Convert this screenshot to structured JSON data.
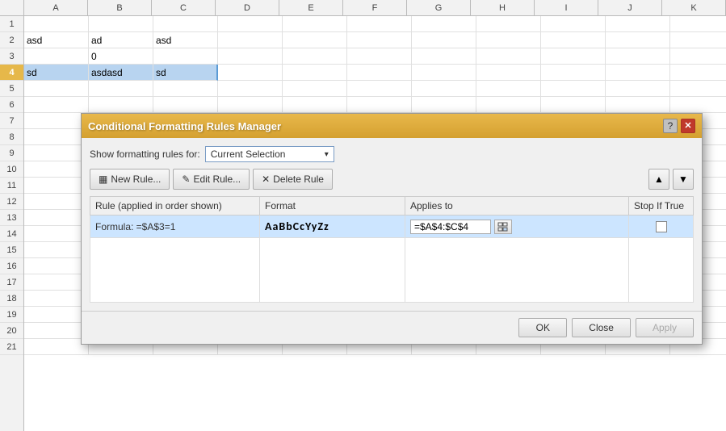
{
  "spreadsheet": {
    "col_headers": [
      "",
      "A",
      "B",
      "C",
      "D",
      "E",
      "F",
      "G",
      "H",
      "I",
      "J",
      "K"
    ],
    "rows": [
      {
        "num": "1",
        "cells": [
          "",
          "",
          "",
          "",
          "",
          "",
          "",
          "",
          "",
          "",
          ""
        ]
      },
      {
        "num": "2",
        "cells": [
          "asd",
          "ad",
          "asd",
          "",
          "",
          "",
          "",
          "",
          "",
          "",
          ""
        ]
      },
      {
        "num": "3",
        "cells": [
          "",
          "0",
          "",
          "",
          "",
          "",
          "",
          "",
          "",
          "",
          ""
        ]
      },
      {
        "num": "4",
        "cells": [
          "sd",
          "asdasd",
          "sd",
          "",
          "",
          "",
          "",
          "",
          "",
          "",
          ""
        ],
        "selected": true
      },
      {
        "num": "5",
        "cells": [
          "",
          "",
          "",
          "",
          "",
          "",
          "",
          "",
          "",
          "",
          ""
        ]
      },
      {
        "num": "6",
        "cells": [
          "",
          "",
          "",
          "",
          "",
          "",
          "",
          "",
          "",
          "",
          ""
        ]
      },
      {
        "num": "7",
        "cells": [
          "",
          "",
          "",
          "",
          "",
          "",
          "",
          "",
          "",
          "",
          ""
        ]
      },
      {
        "num": "8",
        "cells": [
          "",
          "",
          "",
          "",
          "",
          "",
          "",
          "",
          "",
          "",
          ""
        ]
      },
      {
        "num": "9",
        "cells": [
          "",
          "",
          "",
          "",
          "",
          "",
          "",
          "",
          "",
          "",
          ""
        ]
      },
      {
        "num": "10",
        "cells": [
          "",
          "",
          "",
          "",
          "",
          "",
          "",
          "",
          "",
          "",
          ""
        ]
      },
      {
        "num": "11",
        "cells": [
          "",
          "",
          "",
          "",
          "",
          "",
          "",
          "",
          "",
          "",
          ""
        ]
      },
      {
        "num": "12",
        "cells": [
          "",
          "",
          "",
          "",
          "",
          "",
          "",
          "",
          "",
          "",
          ""
        ]
      },
      {
        "num": "13",
        "cells": [
          "",
          "",
          "",
          "",
          "",
          "",
          "",
          "",
          "",
          "",
          ""
        ]
      },
      {
        "num": "14",
        "cells": [
          "",
          "",
          "",
          "",
          "",
          "",
          "",
          "",
          "",
          "",
          ""
        ]
      },
      {
        "num": "15",
        "cells": [
          "",
          "",
          "",
          "",
          "",
          "",
          "",
          "",
          "",
          "",
          ""
        ]
      },
      {
        "num": "16",
        "cells": [
          "",
          "",
          "",
          "",
          "",
          "",
          "",
          "",
          "",
          "",
          ""
        ]
      },
      {
        "num": "17",
        "cells": [
          "",
          "",
          "",
          "",
          "",
          "",
          "",
          "",
          "",
          "",
          ""
        ]
      },
      {
        "num": "18",
        "cells": [
          "",
          "",
          "",
          "",
          "",
          "",
          "",
          "",
          "",
          "",
          ""
        ]
      },
      {
        "num": "19",
        "cells": [
          "",
          "",
          "",
          "",
          "",
          "",
          "",
          "",
          "",
          "",
          ""
        ]
      },
      {
        "num": "20",
        "cells": [
          "",
          "",
          "",
          "",
          "",
          "",
          "",
          "",
          "",
          "",
          ""
        ]
      },
      {
        "num": "21",
        "cells": [
          "",
          "",
          "",
          "",
          "",
          "",
          "",
          "",
          "",
          "",
          ""
        ]
      }
    ]
  },
  "dialog": {
    "title": "Conditional Formatting Rules Manager",
    "show_rules_label": "Show formatting rules for:",
    "current_selection": "Current Selection",
    "new_rule_label": "New Rule...",
    "edit_rule_label": "Edit Rule...",
    "delete_rule_label": "Delete Rule",
    "col_rule": "Rule (applied in order shown)",
    "col_format": "Format",
    "col_applies": "Applies to",
    "col_stop": "Stop If True",
    "rule_formula": "Formula: =$A$3=1",
    "rule_preview": "AaBbCcYyZz",
    "rule_range": "=$A$4:$C$4",
    "ok_label": "OK",
    "close_label": "Close",
    "apply_label": "Apply"
  }
}
